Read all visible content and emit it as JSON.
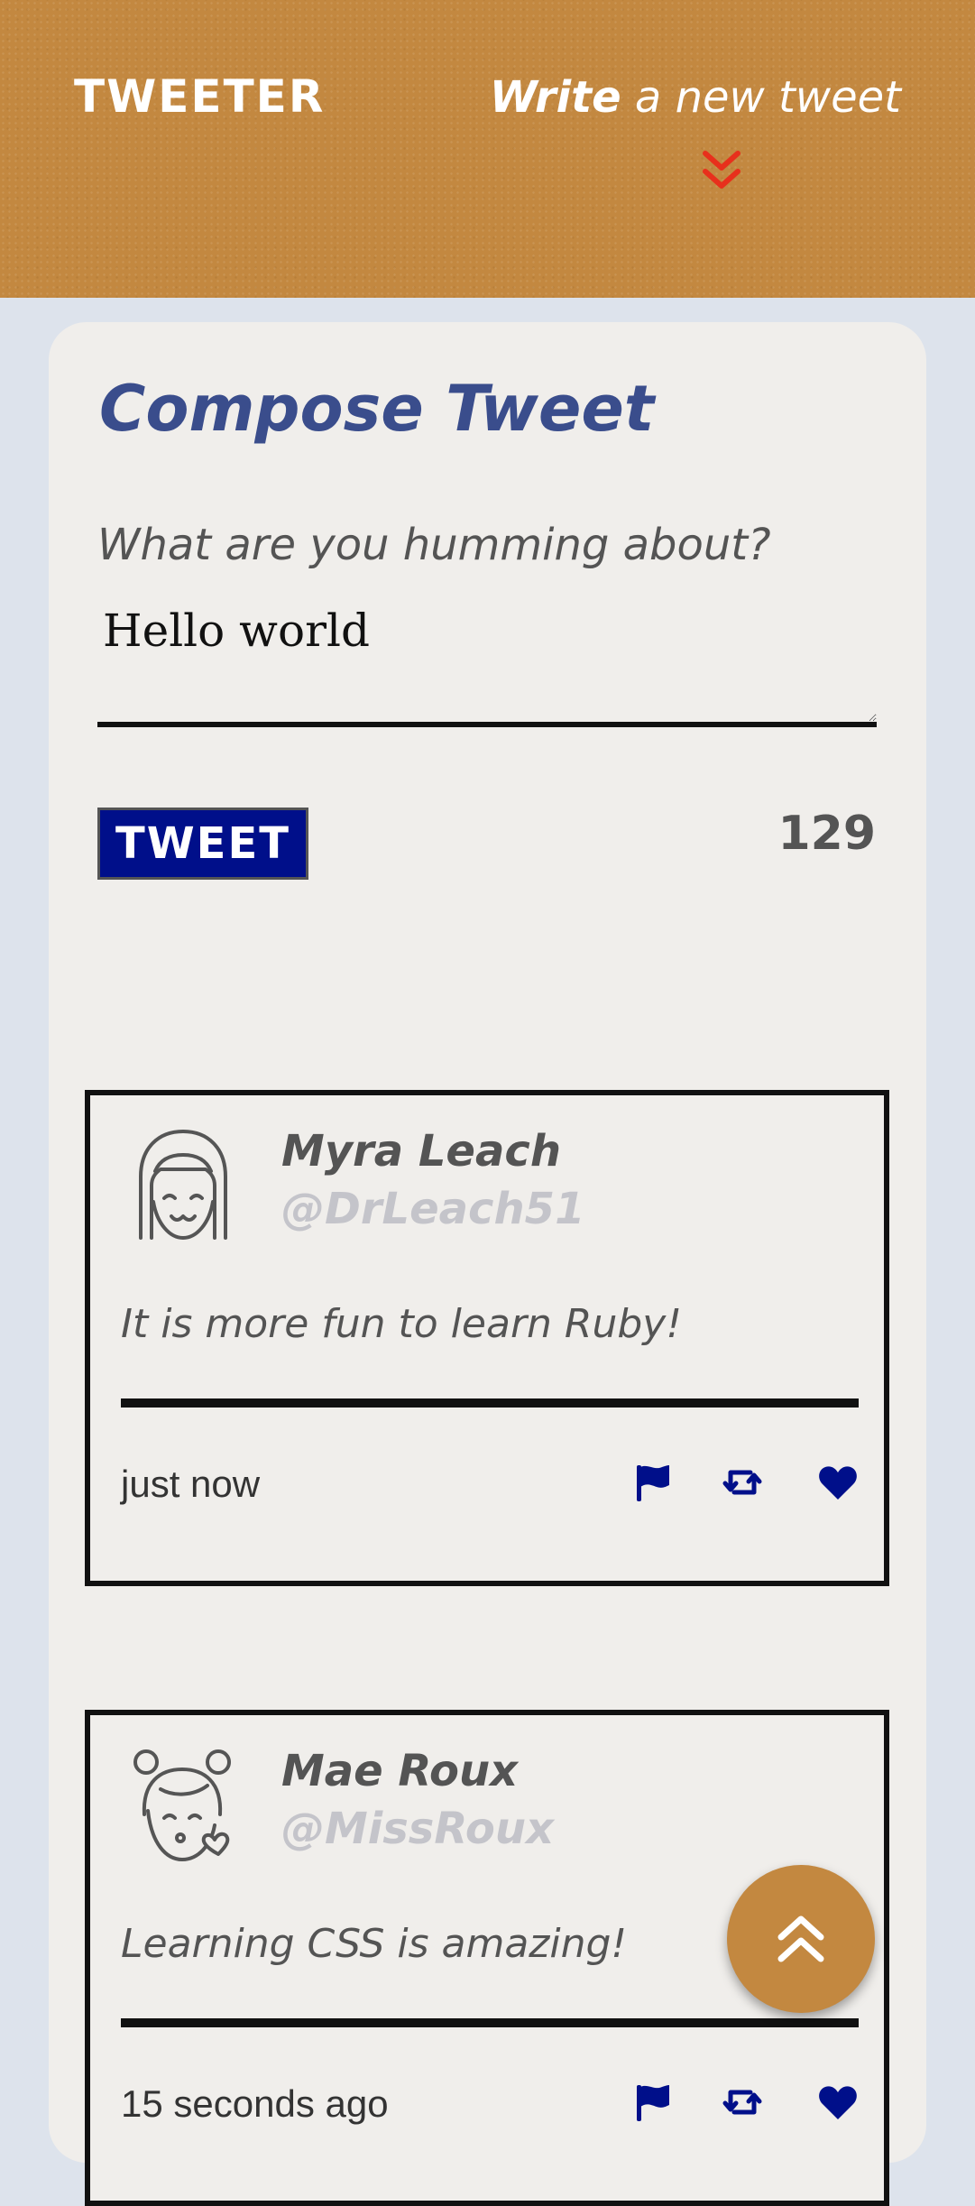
{
  "header": {
    "logo": "TWEETER",
    "write_strong": "Write",
    "write_rest": " a new tweet",
    "chevron_icon": "double-chevron-down-icon",
    "background_color": "#c38840",
    "chevron_color": "#e8301c"
  },
  "compose": {
    "title": "Compose Tweet",
    "label": "What are you humming about?",
    "textarea_value": "Hello world",
    "button_label": "TWEET",
    "counter": "129",
    "button_color": "#000f8a",
    "title_color": "#3a4d8c"
  },
  "tweets": [
    {
      "name": "Myra Leach",
      "handle": "@DrLeach51",
      "text": "It is more fun to learn Ruby!",
      "time": "just now",
      "avatar_icon": "girl-avatar-icon"
    },
    {
      "name": "Mae Roux",
      "handle": "@MissRoux",
      "text": "Learning CSS is amazing!",
      "time": "15 seconds ago",
      "avatar_icon": "kiss-girl-avatar-icon"
    }
  ],
  "actions": {
    "flag_icon": "flag-icon",
    "retweet_icon": "retweet-icon",
    "heart_icon": "heart-icon",
    "icon_color": "#000f8a"
  },
  "scroll_top": {
    "icon": "double-chevron-up-icon"
  }
}
